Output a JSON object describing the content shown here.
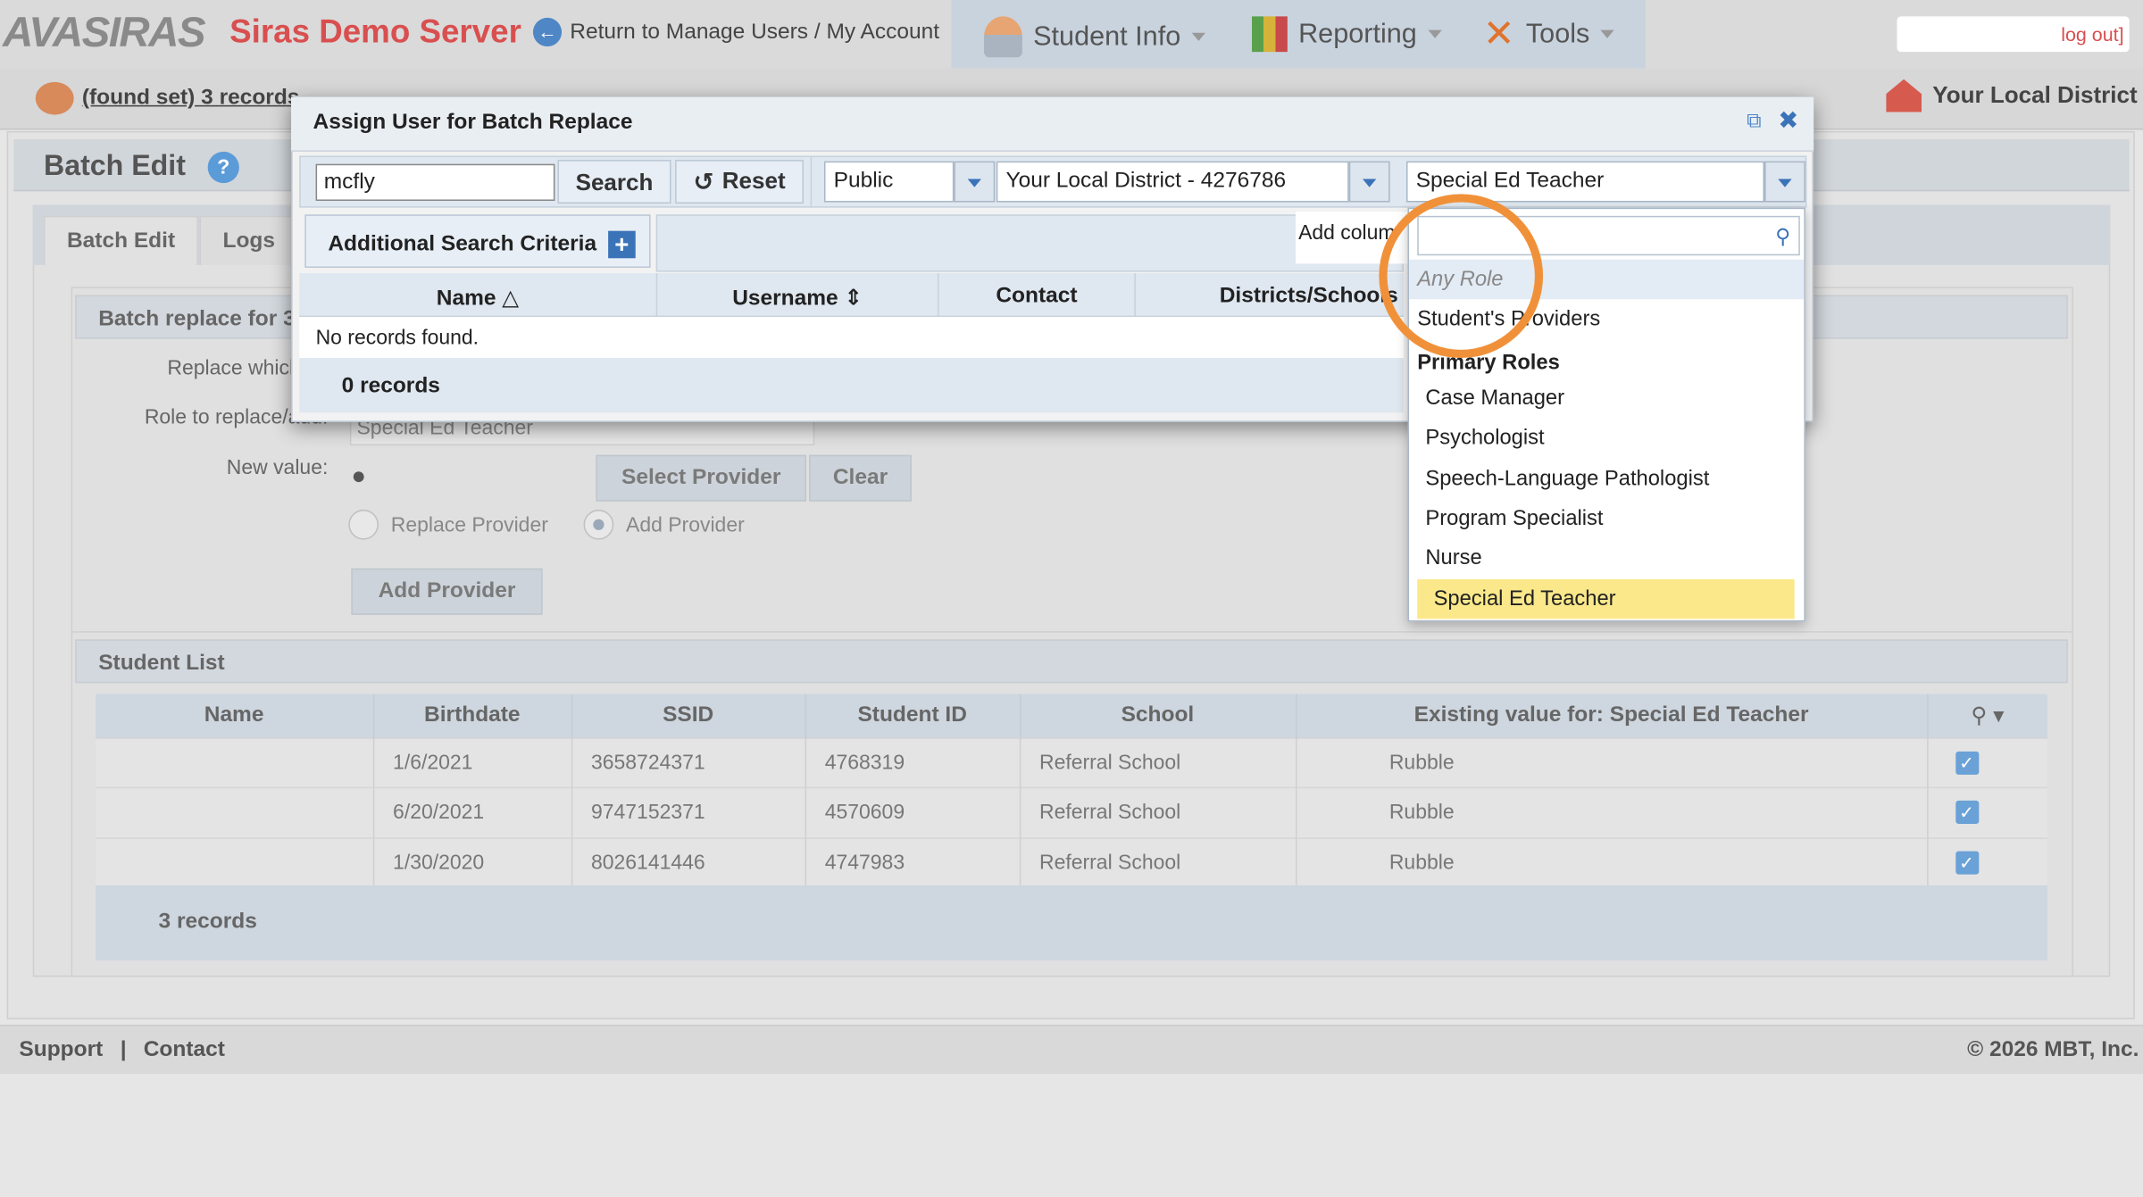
{
  "app": {
    "logo_text": "AVASIRAS",
    "server_name": "Siras Demo Server",
    "return_link": "Return to Manage Users / My Account",
    "logout": "log out]"
  },
  "nav": {
    "items": [
      {
        "label": "Student Info",
        "icon": "student-icon"
      },
      {
        "label": "Reporting",
        "icon": "reporting-icon"
      },
      {
        "label": "Tools",
        "icon": "tools-icon"
      }
    ]
  },
  "subbar": {
    "found_set": "(found set) 3 records",
    "district": "Your Local District"
  },
  "page": {
    "title": "Batch Edit",
    "tabs": [
      "Batch Edit",
      "Logs"
    ],
    "section_title": "Batch replace for 3",
    "replace_label": "Replace which fie",
    "role_label": "Role to replace/add:",
    "role_value": "Special Ed Teacher",
    "new_value_label": "New value:",
    "select_provider": "Select Provider",
    "clear": "Clear",
    "radio_replace": "Replace Provider",
    "radio_add": "Add Provider",
    "add_provider_btn": "Add Provider"
  },
  "student_list": {
    "title": "Student List",
    "columns": [
      "Name",
      "Birthdate",
      "SSID",
      "Student ID",
      "School",
      "Existing value for: Special Ed Teacher"
    ],
    "rows": [
      {
        "name": "",
        "birthdate": "1/6/2021",
        "ssid": "3658724371",
        "student_id": "4768319",
        "school": "Referral School",
        "existing": "Rubble"
      },
      {
        "name": "",
        "birthdate": "6/20/2021",
        "ssid": "9747152371",
        "student_id": "4570609",
        "school": "Referral School",
        "existing": "Rubble"
      },
      {
        "name": "",
        "birthdate": "1/30/2020",
        "ssid": "8026141446",
        "student_id": "4747983",
        "school": "Referral School",
        "existing": "Rubble"
      }
    ],
    "footer": "3 records"
  },
  "footer": {
    "support": "Support",
    "separator": "|",
    "contact": "Contact",
    "copyright": "© 2026 MBT, Inc."
  },
  "modal": {
    "title": "Assign User for Batch Replace",
    "search_value": "mcfly",
    "search_btn": "Search",
    "reset_btn": "Reset",
    "visibility": "Public",
    "district": "Your Local District - 4276786",
    "role": "Special Ed Teacher",
    "additional_criteria": "Additional Search Criteria",
    "add_columns": "Add colum",
    "columns": [
      "Name",
      "Username",
      "Contact",
      "Districts/Schools"
    ],
    "empty_text": "No records found.",
    "footer": "0 records"
  },
  "role_dropdown": {
    "search_value": "",
    "options": [
      {
        "label": "Any Role",
        "kind": "placeholder"
      },
      {
        "label": "Student's Providers",
        "kind": "option"
      },
      {
        "label": "Primary Roles",
        "kind": "group"
      },
      {
        "label": "Case Manager",
        "kind": "option"
      },
      {
        "label": "Psychologist",
        "kind": "option"
      },
      {
        "label": "Speech-Language Pathologist",
        "kind": "option"
      },
      {
        "label": "Program Specialist",
        "kind": "option"
      },
      {
        "label": "Nurse",
        "kind": "option"
      },
      {
        "label": "Special Ed Teacher",
        "kind": "selected"
      }
    ]
  },
  "colors": {
    "brand_red": "#d94f4f",
    "accent_blue": "#3b73b9",
    "highlight_yellow": "#fbe88a",
    "ring_orange": "#f0913a"
  }
}
